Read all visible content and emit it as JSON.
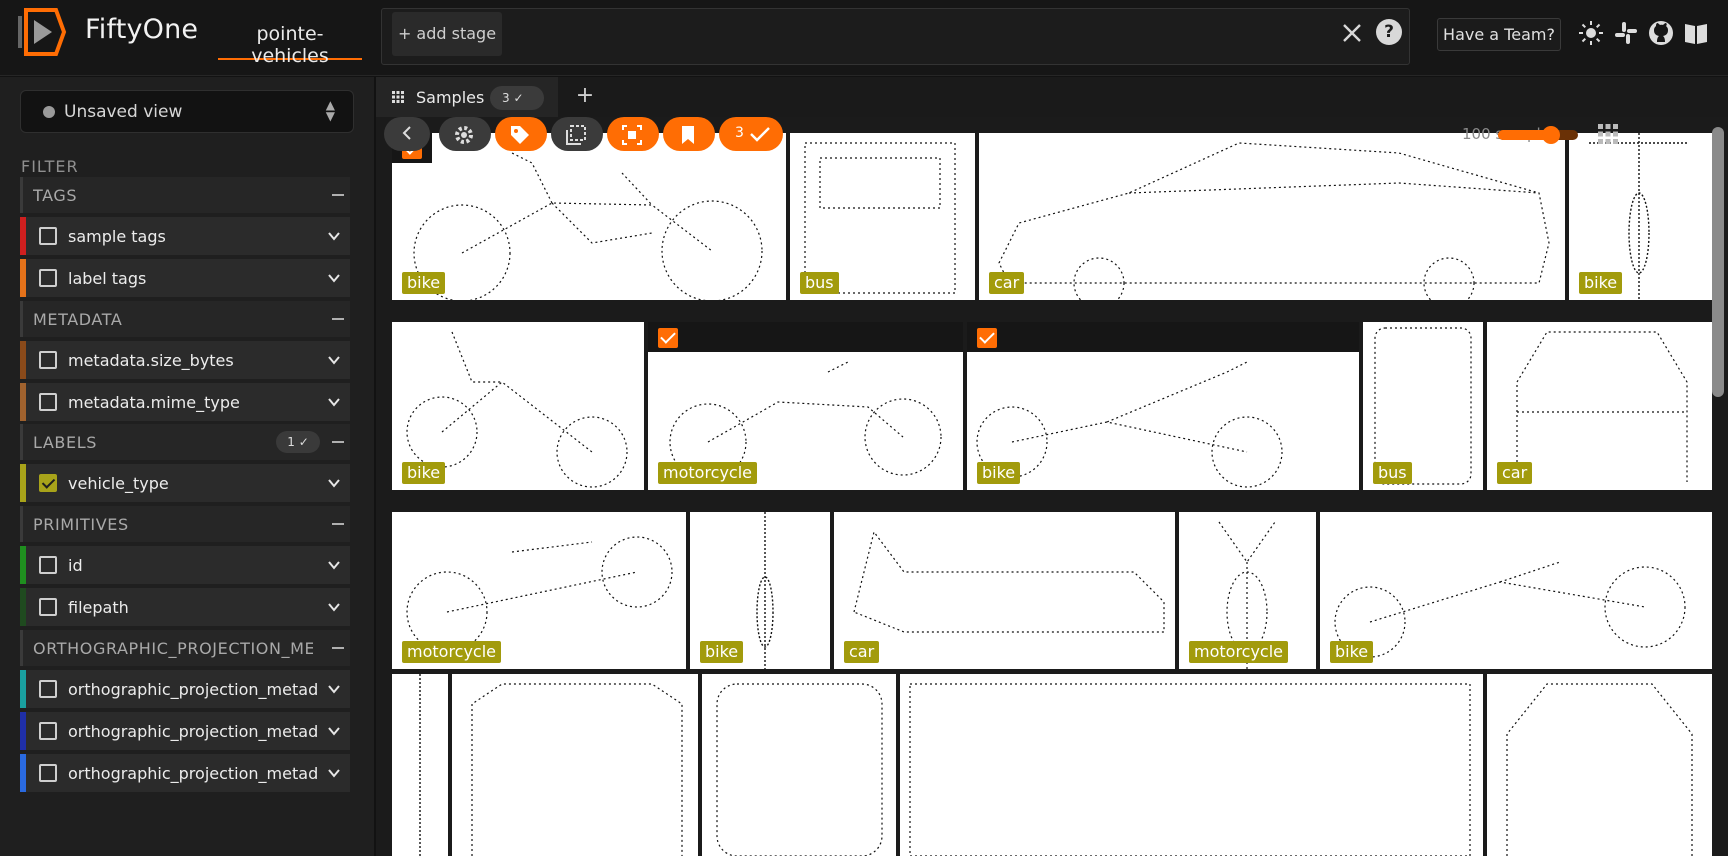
{
  "header": {
    "brand": "FiftyOne",
    "dataset": "pointe-vehicles",
    "add_stage": "+ add stage",
    "help": "?",
    "team_button": "Have a Team?",
    "icons": [
      "theme-icon",
      "slack-icon",
      "github-icon",
      "docs-icon"
    ]
  },
  "sidebar": {
    "view_label": "Unsaved view",
    "filter_title": "FILTER",
    "groups": {
      "tags": "TAGS",
      "metadata": "METADATA",
      "labels": "LABELS",
      "labels_count": "1",
      "primitives": "PRIMITIVES",
      "ortho": "ORTHOGRAPHIC_PROJECTION_MET..."
    },
    "fields": {
      "sample_tags": "sample tags",
      "label_tags": "label tags",
      "size_bytes": "metadata.size_bytes",
      "mime_type": "metadata.mime_type",
      "vehicle_type": "vehicle_type",
      "id": "id",
      "filepath": "filepath",
      "ortho1": "orthographic_projection_metad...",
      "ortho2": "orthographic_projection_metad...",
      "ortho3": "orthographic_projection_metad..."
    },
    "field_colors": {
      "sample_tags": "#cf1f1f",
      "label_tags": "#e5721a",
      "size_bytes": "#8a4a1a",
      "mime_type": "#a0622e",
      "vehicle_type": "#a8a31a",
      "id": "#1f8f1f",
      "filepath": "#1f4a1f",
      "ortho1": "#1aa0a0",
      "ortho2": "#1f2fa8",
      "ortho3": "#2a6ae0"
    }
  },
  "main": {
    "tab_label": "Samples",
    "tab_badge": "3",
    "tab_add": "+",
    "selected_count": "3",
    "sample_count": "100 samples",
    "accent": "#ff6d04",
    "label_color": "#a29b0c",
    "tiles": [
      {
        "label": "bike",
        "selected": true
      },
      {
        "label": "bus",
        "selected": false
      },
      {
        "label": "car",
        "selected": false
      },
      {
        "label": "bike",
        "selected": false
      },
      {
        "label": "bike",
        "selected": false
      },
      {
        "label": "motorcycle",
        "selected": true
      },
      {
        "label": "bike",
        "selected": true
      },
      {
        "label": "bus",
        "selected": false
      },
      {
        "label": "car",
        "selected": false
      },
      {
        "label": "motorcycle",
        "selected": false
      },
      {
        "label": "bike",
        "selected": false
      },
      {
        "label": "car",
        "selected": false
      },
      {
        "label": "motorcycle",
        "selected": false
      },
      {
        "label": "bike",
        "selected": false
      }
    ]
  }
}
